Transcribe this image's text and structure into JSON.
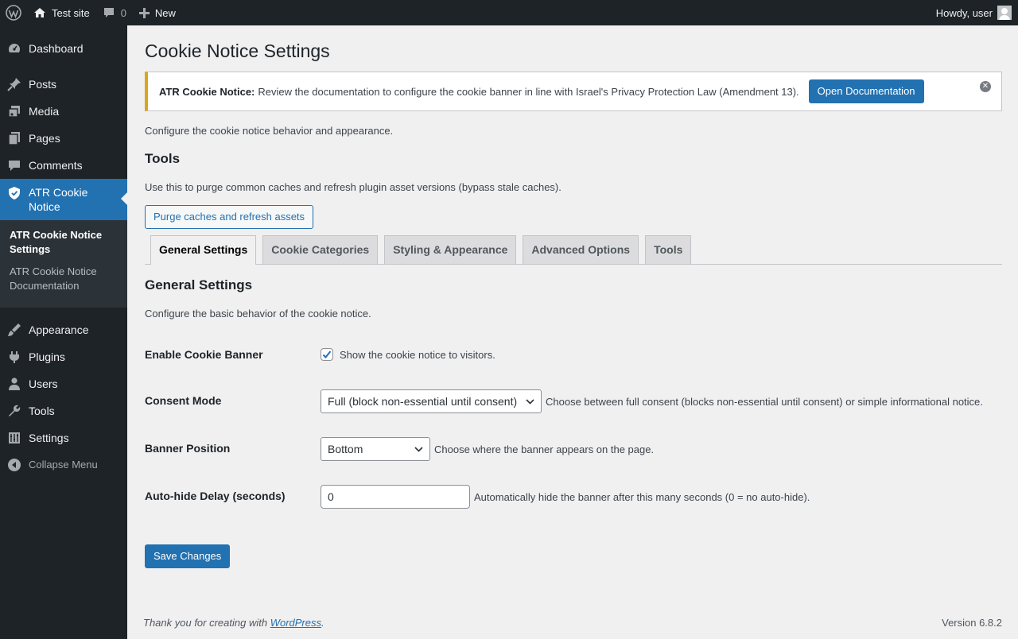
{
  "adminbar": {
    "site_name": "Test site",
    "comments_count": "0",
    "new_label": "New",
    "howdy": "Howdy, user"
  },
  "sidebar": {
    "items": [
      {
        "label": "Dashboard",
        "icon": "dashboard-icon"
      },
      {
        "label": "Posts",
        "icon": "pin-icon"
      },
      {
        "label": "Media",
        "icon": "media-icon"
      },
      {
        "label": "Pages",
        "icon": "pages-icon"
      },
      {
        "label": "Comments",
        "icon": "comment-icon"
      },
      {
        "label": "ATR Cookie Notice",
        "icon": "shield-icon"
      },
      {
        "label": "Appearance",
        "icon": "brush-icon"
      },
      {
        "label": "Plugins",
        "icon": "plug-icon"
      },
      {
        "label": "Users",
        "icon": "user-icon"
      },
      {
        "label": "Tools",
        "icon": "wrench-icon"
      },
      {
        "label": "Settings",
        "icon": "settings-icon"
      }
    ],
    "submenu": [
      {
        "label": "ATR Cookie Notice Settings"
      },
      {
        "label": "ATR Cookie Notice Documentation"
      }
    ],
    "collapse_label": "Collapse Menu"
  },
  "page": {
    "title": "Cookie Notice Settings",
    "notice": {
      "strong": "ATR Cookie Notice:",
      "text": "Review the documentation to configure the cookie banner in line with Israel's Privacy Protection Law (Amendment 13).",
      "button": "Open Documentation"
    },
    "intro": "Configure the cookie notice behavior and appearance.",
    "tools_heading": "Tools",
    "tools_desc": "Use this to purge common caches and refresh plugin asset versions (bypass stale caches).",
    "purge_button": "Purge caches and refresh assets",
    "tabs": [
      {
        "label": "General Settings",
        "active": true
      },
      {
        "label": "Cookie Categories"
      },
      {
        "label": "Styling & Appearance"
      },
      {
        "label": "Advanced Options"
      },
      {
        "label": "Tools"
      }
    ],
    "section_heading": "General Settings",
    "section_desc": "Configure the basic behavior of the cookie notice.",
    "fields": {
      "enable_banner": {
        "label": "Enable Cookie Banner",
        "checked": true,
        "desc": "Show the cookie notice to visitors."
      },
      "consent_mode": {
        "label": "Consent Mode",
        "value": "Full (block non-essential until consent)",
        "desc": "Choose between full consent (blocks non-essential until consent) or simple informational notice."
      },
      "banner_position": {
        "label": "Banner Position",
        "value": "Bottom",
        "desc": "Choose where the banner appears on the page."
      },
      "autohide_delay": {
        "label": "Auto-hide Delay (seconds)",
        "value": "0",
        "desc": "Automatically hide the banner after this many seconds (0 = no auto-hide)."
      }
    },
    "save_button": "Save Changes"
  },
  "footer": {
    "thanks_prefix": "Thank you for creating with ",
    "thanks_link": "WordPress",
    "thanks_suffix": ".",
    "version": "Version 6.8.2"
  },
  "colors": {
    "accent": "#2271b1",
    "admin_bg": "#1d2327",
    "notice_warning": "#dba617"
  }
}
